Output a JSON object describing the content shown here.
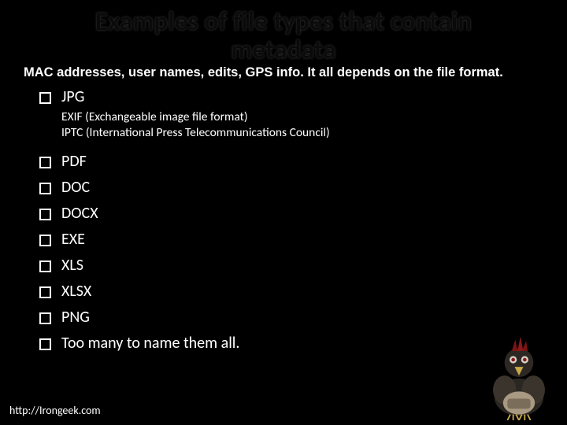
{
  "title_line1": "Examples of file types that contain",
  "title_line2": "metadata",
  "subtitle": "MAC addresses, user names, edits, GPS info. It all depends on the file format.",
  "items": {
    "i0": "JPG",
    "i1": "PDF",
    "i2": "DOC",
    "i3": "DOCX",
    "i4": "EXE",
    "i5": "XLS",
    "i6": "XLSX",
    "i7": "PNG",
    "i8": "Too many to name them all."
  },
  "jpg_sub1": "EXIF (Exchangeable image file format)",
  "jpg_sub2": "IPTC (International Press Telecommunications Council)",
  "footer": "http://Irongeek.com"
}
